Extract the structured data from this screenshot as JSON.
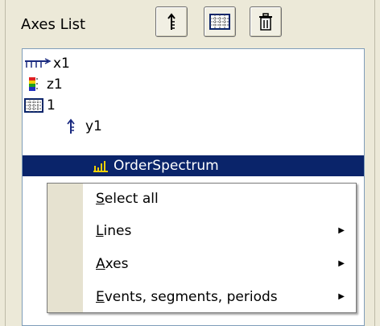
{
  "panel": {
    "title": "Axes List",
    "toolbar": [
      {
        "name": "add-axis-button",
        "icon": "vertical-axis-icon"
      },
      {
        "name": "grid-button",
        "icon": "grid-icon"
      },
      {
        "name": "delete-button",
        "icon": "trash-icon"
      }
    ]
  },
  "tree": {
    "items": [
      {
        "label": "x1",
        "icon": "x-axis-icon"
      },
      {
        "label": "z1",
        "icon": "color-scale-icon"
      },
      {
        "label": "1",
        "icon": "grid-icon"
      },
      {
        "label": "y1",
        "icon": "y-axis-icon"
      },
      {
        "label": "OrderSpectrum",
        "icon": "bar-chart-icon",
        "selected": true
      }
    ]
  },
  "context_menu": {
    "items": [
      {
        "accel": "S",
        "rest": "elect all",
        "submenu": false
      },
      {
        "accel": "L",
        "rest": "ines",
        "submenu": true
      },
      {
        "accel": "A",
        "rest": "xes",
        "submenu": true
      },
      {
        "accel": "E",
        "rest": "vents, segments, periods",
        "submenu": true
      }
    ]
  },
  "colors": {
    "selection_bg": "#0a246a",
    "selection_fg": "#ffffff",
    "panel_bg": "#ece9d8",
    "menu_stripe": "#e6e2d0"
  }
}
